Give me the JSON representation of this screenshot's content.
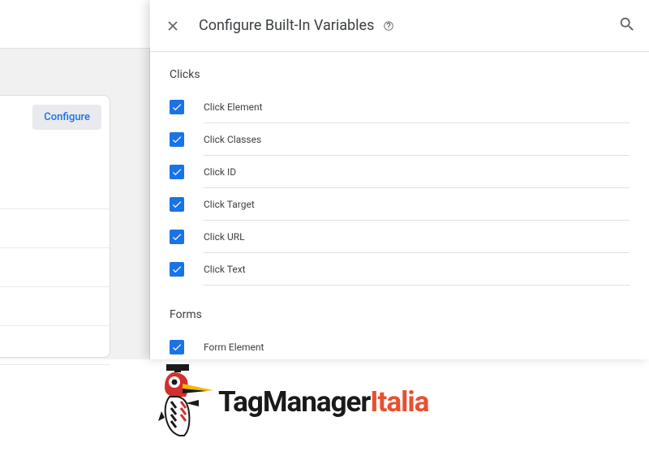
{
  "backdrop": {
    "configure_label": "Configure"
  },
  "panel": {
    "title": "Configure Built-In Variables"
  },
  "sections": [
    {
      "title": "Clicks",
      "items": [
        {
          "label": "Click Element",
          "checked": true
        },
        {
          "label": "Click Classes",
          "checked": true
        },
        {
          "label": "Click ID",
          "checked": true
        },
        {
          "label": "Click Target",
          "checked": true
        },
        {
          "label": "Click URL",
          "checked": true
        },
        {
          "label": "Click Text",
          "checked": true
        }
      ]
    },
    {
      "title": "Forms",
      "items": [
        {
          "label": "Form Element",
          "checked": true
        }
      ]
    }
  ],
  "logo": {
    "text1": "TagManager",
    "text2": "Italia"
  }
}
